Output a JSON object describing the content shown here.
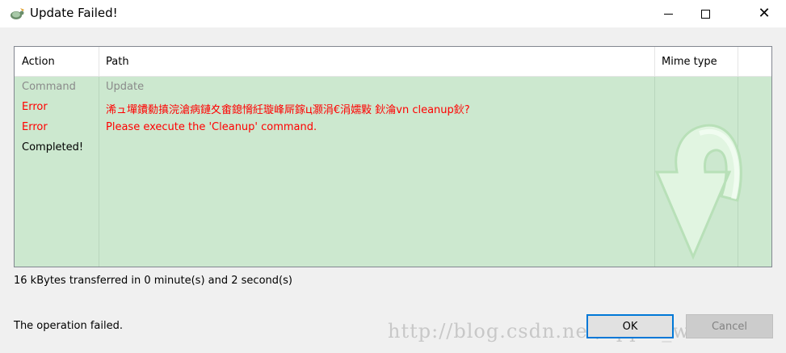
{
  "window": {
    "title": "Update Failed!",
    "icon": "tortoise-svn-icon"
  },
  "list": {
    "columns": [
      "Action",
      "Path",
      "Mime type"
    ],
    "rows": [
      {
        "action": "Command",
        "path": "Update",
        "color": "#8a8a8a"
      },
      {
        "action": "Error",
        "path": "浠ュ墠鐨勬搷浣滄病鏈夊畬鎴愶紝璇峰厛鎵ц灏涓€涓嬬敤 鈥淪vn cleanup鈥?",
        "color": "#ff0000"
      },
      {
        "action": "Error",
        "path": "Please execute the 'Cleanup' command.",
        "color": "#ff0000"
      },
      {
        "action": "Completed!",
        "path": "",
        "color": "#000000"
      }
    ]
  },
  "status_text": "16 kBytes transferred in 0 minute(s) and 2 second(s)",
  "footer": {
    "message": "The operation failed.",
    "watermark": "http://blog.csdn.net/apple_wheat",
    "ok_label": "OK",
    "cancel_label": "Cancel"
  },
  "colors": {
    "list_background": "#cce8cf",
    "error": "#ff0000",
    "muted": "#8a8a8a",
    "ok_border": "#0078d7"
  }
}
